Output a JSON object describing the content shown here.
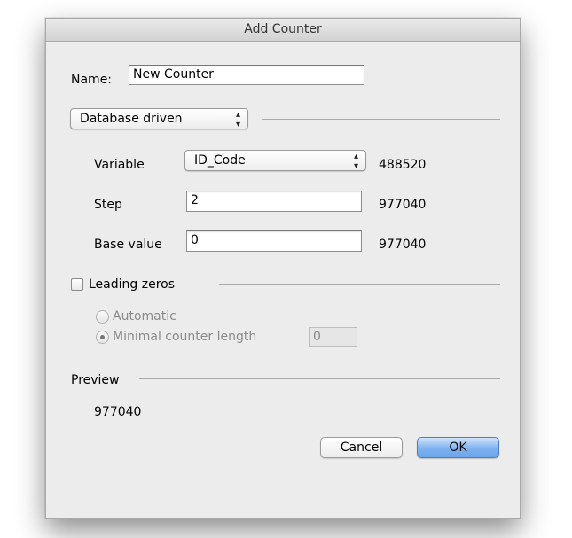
{
  "window": {
    "title": "Add Counter"
  },
  "name": {
    "label": "Name:",
    "value": "New Counter"
  },
  "source_popup": {
    "selected": "Database driven"
  },
  "variable": {
    "label": "Variable",
    "selected": "ID_Code",
    "result": "488520"
  },
  "step": {
    "label": "Step",
    "value": "2",
    "result": "977040"
  },
  "base": {
    "label": "Base value",
    "value": "0",
    "result": "977040"
  },
  "leading_zeros": {
    "label": "Leading zeros",
    "checked": false
  },
  "options": {
    "automatic": "Automatic",
    "minimal": "Minimal counter length",
    "minimal_value": "0"
  },
  "preview": {
    "label": "Preview",
    "value": "977040"
  },
  "buttons": {
    "cancel": "Cancel",
    "ok": "OK"
  },
  "colors": {
    "window_bg": "#ececec",
    "default_button": "#7fb2ef"
  }
}
